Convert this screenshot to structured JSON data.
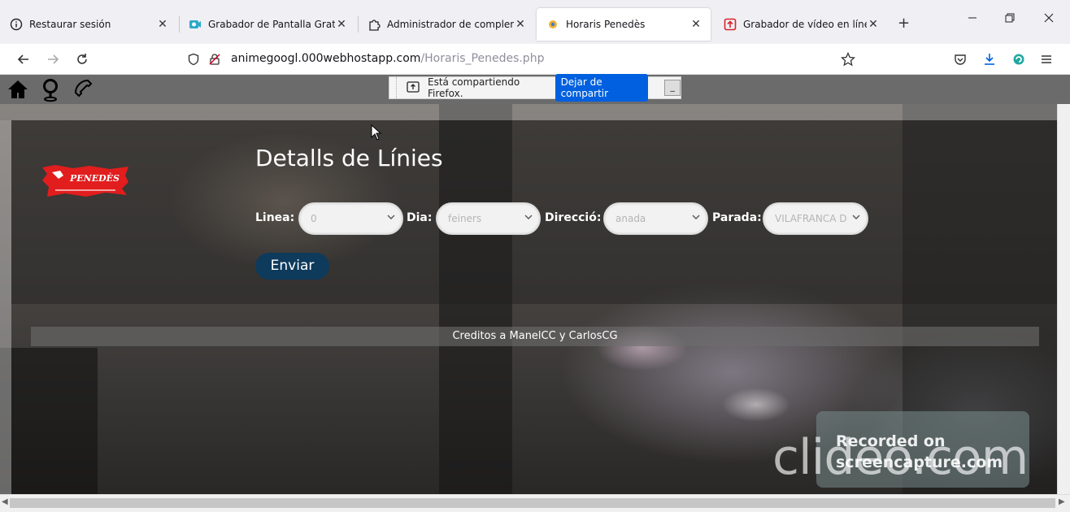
{
  "browser": {
    "tabs": [
      {
        "title": "Restaurar sesión",
        "icon": "info-icon",
        "active": false
      },
      {
        "title": "Grabador de Pantalla Gratis – C",
        "icon": "screen-recorder-icon",
        "active": false
      },
      {
        "title": "Administrador de complementos",
        "icon": "puzzle-icon",
        "active": false
      },
      {
        "title": "Horaris Penedès",
        "icon": "site-favicon-icon",
        "active": true
      },
      {
        "title": "Grabador de vídeo en línea gra",
        "icon": "upload-red-icon",
        "active": false
      }
    ],
    "close_glyph": "✕",
    "new_tab_glyph": "+",
    "url_host": "animegoogl.000webhostapp.com",
    "url_path": "/Horaris_Penedes.php",
    "share_label": "Está compartiendo Firefox.",
    "share_stop_label": "Dejar de compartir",
    "share_min_label": "_"
  },
  "site": {
    "nav_icons": [
      "home-icon",
      "location-pin-icon",
      "phone-icon"
    ],
    "logo_text": "PENEDÈS",
    "title": "Detalls de Línies",
    "form": {
      "line_label": "Linea:",
      "line_value": "0",
      "day_label": "Dia:",
      "day_value": "feiners",
      "direction_label": "Direcció:",
      "direction_value": "anada",
      "stop_label": "Parada:",
      "stop_value": "VILAFRANCA D"
    },
    "send_label": "Enviar",
    "credits": "Creditos a ManelCC y CarlosCG"
  },
  "watermark": {
    "brand": "clideo.com",
    "line1": "Recorded on",
    "line2": "screencapture.com"
  },
  "colors": {
    "accent_blue": "#0060df",
    "send_button": "#0e3a5c",
    "logo_red": "#e21d1d"
  }
}
